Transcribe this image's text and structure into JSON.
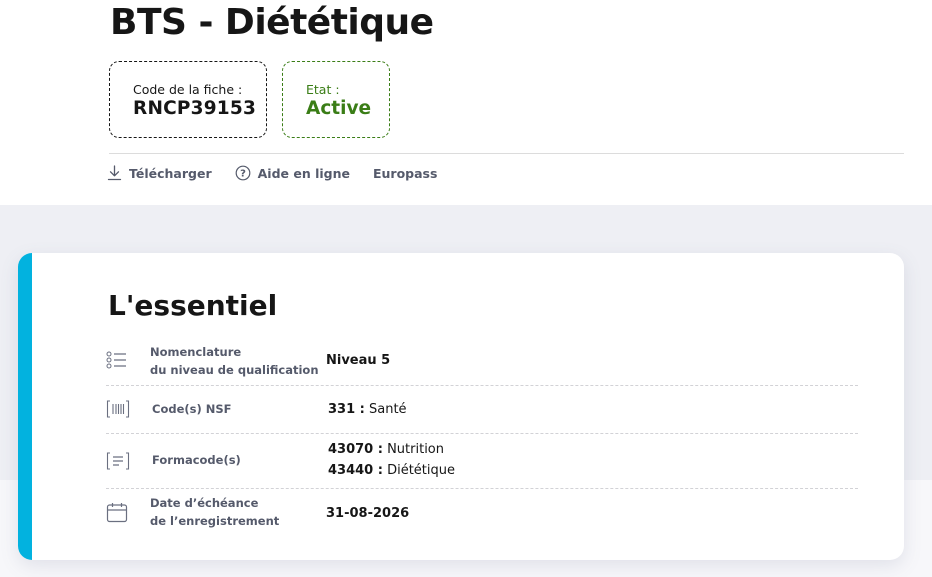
{
  "page": {
    "title": "BTS - Diététique"
  },
  "fiche": {
    "code_label": "Code de la fiche :",
    "code_value": "RNCP39153",
    "state_label": "Etat :",
    "state_value": "Active"
  },
  "actions": [
    {
      "label": "Télécharger",
      "icon": "download-icon"
    },
    {
      "label": "Aide en ligne",
      "icon": "help-icon"
    },
    {
      "label": "Europass",
      "icon": ""
    }
  ],
  "essentiel": {
    "title": "L'essentiel",
    "rows": [
      {
        "icon": "list-icon",
        "label_line1": "Nomenclature",
        "label_line2": "du niveau de qualification",
        "value": "Niveau 5"
      },
      {
        "icon": "barcode-icon",
        "label_line1": "Code(s) NSF",
        "values": [
          {
            "code": "331 :",
            "text": " Santé"
          }
        ]
      },
      {
        "icon": "code-list-icon",
        "label_line1": "Formacode(s)",
        "values": [
          {
            "code": "43070 :",
            "text": " Nutrition"
          },
          {
            "code": "43440 :",
            "text": " Diététique"
          }
        ]
      },
      {
        "icon": "calendar-icon",
        "label_line1": "Date d’échéance",
        "label_line2": "de l’enregistrement",
        "value": "31-08-2026"
      }
    ]
  },
  "colors": {
    "accent": "#02b2df",
    "state_green": "#3a7d16",
    "label_grey": "#555a6b",
    "band_grey": "#eeeff4"
  }
}
